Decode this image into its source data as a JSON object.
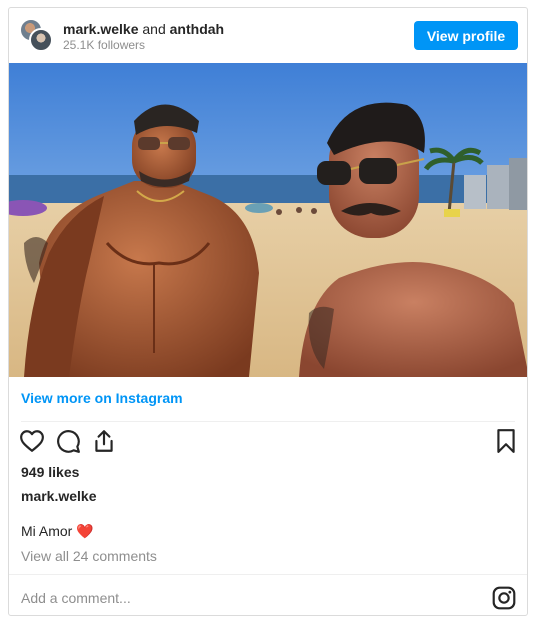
{
  "header": {
    "user1": "mark.welke",
    "connector": "and",
    "user2": "anthdah",
    "followers": "25.1K followers",
    "view_profile_label": "View profile"
  },
  "post": {
    "view_more_label": "View more on Instagram",
    "likes": "949 likes",
    "caption_user": "mark.welke",
    "caption_text": "Mi Amor",
    "caption_emoji": "❤️",
    "comments_link": "View all 24 comments",
    "add_comment_placeholder": "Add a comment..."
  },
  "icons": {
    "like": "heart-icon",
    "comment": "comment-icon",
    "share": "share-icon",
    "save": "bookmark-icon",
    "instagram": "instagram-icon"
  },
  "colors": {
    "accent": "#0095f6",
    "text": "#262626",
    "muted": "#8e8e8e",
    "border": "#dbdbdb"
  }
}
